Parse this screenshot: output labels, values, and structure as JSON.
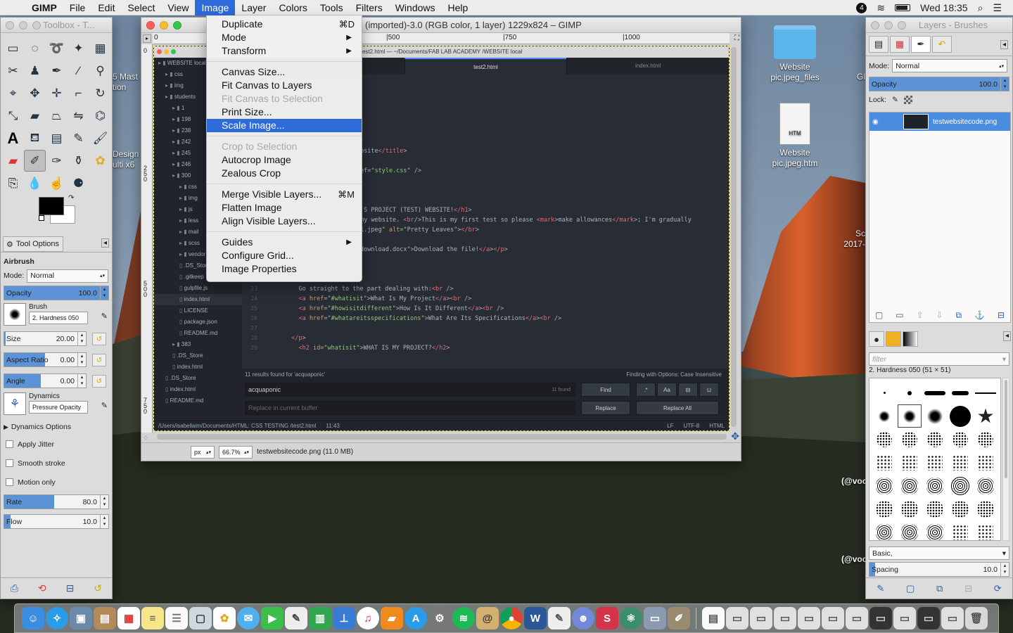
{
  "menubar": {
    "app": "GIMP",
    "items": [
      "File",
      "Edit",
      "Select",
      "View",
      "Image",
      "Layer",
      "Colors",
      "Tools",
      "Filters",
      "Windows",
      "Help"
    ],
    "active": "Image",
    "clock": "Wed 18:35",
    "notif_count": "4"
  },
  "toolbox": {
    "title": "Toolbox - T...",
    "tab_label": "Tool Options",
    "tool_name": "Airbrush",
    "mode_label": "Mode:",
    "mode_value": "Normal",
    "opacity_label": "Opacity",
    "opacity_value": "100.0",
    "brush_label": "Brush",
    "brush_value": "2. Hardness 050",
    "size_label": "Size",
    "size_value": "20.00",
    "aspect_label": "Aspect Ratio",
    "aspect_value": "0.00",
    "angle_label": "Angle",
    "angle_value": "0.00",
    "dynamics_label": "Dynamics",
    "dynamics_value": "Pressure Opacity",
    "dynamics_options": "Dynamics Options",
    "apply_jitter": "Apply Jitter",
    "smooth_stroke": "Smooth stroke",
    "motion_only": "Motion only",
    "rate_label": "Rate",
    "rate_value": "80.0",
    "flow_label": "Flow",
    "flow_value": "10.0"
  },
  "image_window": {
    "title": "(imported)-3.0 (RGB color, 1 layer) 1229x824 – GIMP",
    "ruler_marks": [
      "0",
      "|500",
      "|750",
      "|1000"
    ],
    "vruler_marks": [
      "0",
      "250",
      "500",
      "750"
    ],
    "unit": "px",
    "zoom": "66.7%",
    "status": "testwebsitecode.png (11.0 MB)"
  },
  "editor": {
    "window_title": "test2.html — ~/Documents/FAB LAB ACADEMY /WEBSITE local",
    "tabs": [
      "page2.html",
      "test2.html",
      "index.html"
    ],
    "tree": [
      "WEBSITE local",
      "css",
      "img",
      "students",
      "1",
      "198",
      "238",
      "242",
      "245",
      "246",
      "300",
      "css",
      "img",
      "js",
      "less",
      "mail",
      "scss",
      "vendor",
      ".DS_Store",
      ".gitkeep",
      "gulpfile.js",
      "index.html",
      "LICENSE",
      "package.json",
      "README.md",
      "383",
      ".DS_Store",
      "index.html",
      ".DS_Store",
      "index.html",
      "README.md"
    ],
    "code": [
      {
        "n": "",
        "t": "bsite</title>"
      },
      {
        "n": "",
        "t": "ef=\"style.css\" />"
      },
      {
        "n": "",
        "t": "'S PROJECT (TEST) WEBSITE!</h1>"
      },
      {
        "n": "",
        "t": "my website. <br/>This is my first test so please <mark>make allowances</mark>; I'm gradually"
      },
      {
        "n": "",
        "t": "1.jpeg\" alt=\"Pretty Leaves\"></br>"
      },
      {
        "n": "",
        "t": "download.docx\">Download the file!</a></p>"
      },
      {
        "n": "22",
        "t": "  <p>"
      },
      {
        "n": "23",
        "t": "    Go straight to the part dealing with:<br />"
      },
      {
        "n": "24",
        "t": "    <a href=\"#whatisit\">What Is My Project</a><br />"
      },
      {
        "n": "25",
        "t": "    <a href=\"#howisitdifferent\">How Is It Different</a><br />"
      },
      {
        "n": "26",
        "t": "    <a href=\"#whatareitsspecifications\">What Are Its Specifications</a><br />"
      },
      {
        "n": "27",
        "t": ""
      },
      {
        "n": "28",
        "t": "  </p>"
      },
      {
        "n": "29",
        "t": "    <h2 id=\"whatisit\">WHAT IS MY PROJECT?</h2>"
      }
    ],
    "find_results": "11 results found for 'acquaponic'",
    "find_options": "Finding with Options: Case Insensitive",
    "find_query": "acquaponic",
    "find_count": "11 found",
    "replace_placeholder": "Replace in current buffer",
    "find_btn": "Find",
    "replace_btn": "Replace",
    "replace_all_btn": "Replace All",
    "regex_btn": ".*",
    "case_btn": "Aa",
    "status_path": "/Users/isabellaim/Documents/HTML: CSS TESTING /test2.html",
    "status_pos": "11:43",
    "status_lf": "LF",
    "status_enc": "UTF-8",
    "status_lang": "HTML"
  },
  "image_menu": [
    {
      "label": "Duplicate",
      "shortcut": "⌘D",
      "state": "normal"
    },
    {
      "label": "Mode",
      "submenu": true,
      "state": "normal"
    },
    {
      "label": "Transform",
      "submenu": true,
      "state": "normal"
    },
    {
      "sep": true
    },
    {
      "label": "Canvas Size...",
      "state": "normal"
    },
    {
      "label": "Fit Canvas to Layers",
      "state": "normal"
    },
    {
      "label": "Fit Canvas to Selection",
      "state": "disabled"
    },
    {
      "label": "Print Size...",
      "state": "normal"
    },
    {
      "label": "Scale Image...",
      "state": "highlighted"
    },
    {
      "sep": true
    },
    {
      "label": "Crop to Selection",
      "state": "disabled"
    },
    {
      "label": "Autocrop Image",
      "state": "normal"
    },
    {
      "label": "Zealous Crop",
      "state": "normal"
    },
    {
      "sep": true
    },
    {
      "label": "Merge Visible Layers...",
      "shortcut": "⌘M",
      "state": "normal"
    },
    {
      "label": "Flatten Image",
      "state": "normal"
    },
    {
      "label": "Align Visible Layers...",
      "state": "normal"
    },
    {
      "sep": true
    },
    {
      "label": "Guides",
      "submenu": true,
      "state": "normal"
    },
    {
      "label": "Configure Grid...",
      "state": "normal"
    },
    {
      "label": "Image Properties",
      "state": "normal"
    }
  ],
  "layers": {
    "title": "Layers - Brushes",
    "mode_label": "Mode:",
    "mode_value": "Normal",
    "opacity_label": "Opacity",
    "opacity_value": "100.0",
    "lock_label": "Lock:",
    "layer_name": "testwebsitecode.png",
    "filter_placeholder": "filter",
    "brush_name": "2. Hardness 050 (51 × 51)",
    "preset": "Basic,",
    "spacing_label": "Spacing",
    "spacing_value": "10.0"
  },
  "desktop": {
    "icons": [
      {
        "label": "Website pic.jpeg_files"
      },
      {
        "label": "Website pic.jpeg.htm"
      }
    ],
    "partial_left": [
      "5 Mast",
      "tion",
      "Design",
      "ulti x6"
    ],
    "partial_right": [
      "Gl",
      "Sc",
      "2017-",
      "(@voc",
      "(@voc"
    ],
    "file_badge": "HTM"
  },
  "colors": {
    "accent": "#2e6ad8",
    "layer_selected": "#4a8de0",
    "slider_fill": "#5b93d6"
  }
}
